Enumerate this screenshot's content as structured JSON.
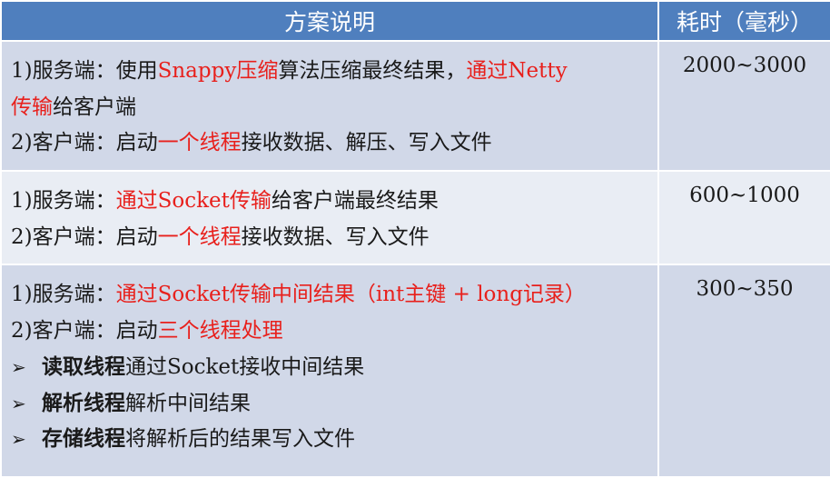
{
  "header": {
    "col_desc": "方案说明",
    "col_time": "耗时（毫秒）"
  },
  "colors": {
    "header_bg": "#4f7fbe",
    "highlight": "#e8201c",
    "row_odd": "#d1d8e8",
    "row_even": "#e9edf4"
  },
  "rows": [
    {
      "time": "2000~3000",
      "lines": [
        {
          "pre": "1)服务端：使用",
          "hl1": "Snappy压缩",
          "mid": "算法压缩最终结果，",
          "hl2": "通过Netty"
        },
        {
          "hl": "传输",
          "post": "给客户端"
        },
        {
          "pre": "2)客户端：启动",
          "hl": "一个线程",
          "post": "接收数据、解压、写入文件"
        }
      ]
    },
    {
      "time": "600~1000",
      "lines": [
        {
          "pre": "1)服务端：",
          "hl": "通过Socket传输",
          "post": "给客户端最终结果"
        },
        {
          "pre": "2)客户端：启动",
          "hl": "一个线程",
          "post": "接收数据、写入文件"
        }
      ]
    },
    {
      "time": "300~350",
      "lines": [
        {
          "pre": "1)服务端：",
          "hl": "通过Socket传输中间结果（int主键 + long记录）"
        },
        {
          "pre": "2)客户端：启动",
          "hl": "三个线程处理"
        }
      ],
      "bullets": [
        {
          "marker": "➢",
          "bold": "读取线程",
          "rest": "通过Socket接收中间结果"
        },
        {
          "marker": "➢",
          "bold": "解析线程",
          "rest": "解析中间结果"
        },
        {
          "marker": "➢",
          "bold": "存储线程",
          "rest": "将解析后的结果写入文件"
        }
      ]
    }
  ]
}
